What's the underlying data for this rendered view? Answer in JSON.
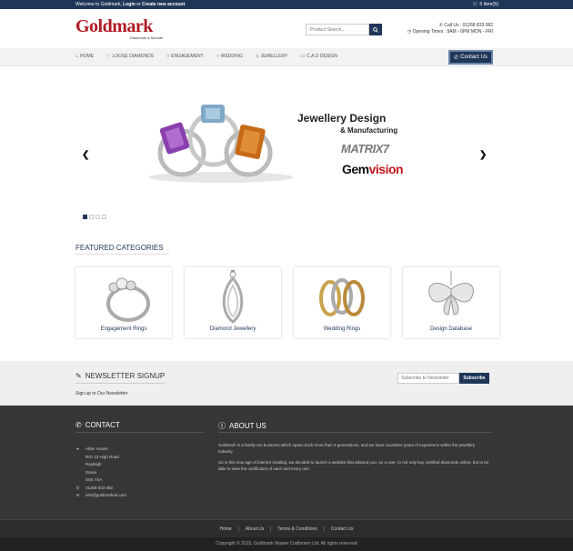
{
  "topbar": {
    "welcome_prefix": "Welcome to Goldmark,",
    "login": "Login",
    "or": "or",
    "create_account": "Create new account",
    "cart": "0 Item(S)"
  },
  "header": {
    "logo_text": "Goldmark",
    "logo_sub": "Diamonds & Mounts",
    "search_placeholder": "Product Search...",
    "call_us": "Call Us : 01268 833 082",
    "opening_times": "Opening Times : 9AM - 6PM MON - FRI"
  },
  "nav": {
    "items": [
      {
        "label": "Home"
      },
      {
        "label": "Loose Diamonds"
      },
      {
        "label": "Engagement"
      },
      {
        "label": "Wedding"
      },
      {
        "label": "Jewellery"
      },
      {
        "label": "C.A.D Design"
      }
    ],
    "contact_label": "Contact Us"
  },
  "slider": {
    "title": "Jewellery Design",
    "subtitle": "& Manufacturing",
    "matrix": "MATRIX7",
    "gem_a": "Gem",
    "gem_b": "vision",
    "slide_count": 4,
    "active_slide": 1
  },
  "featured": {
    "title": "Featured Categories",
    "cards": [
      {
        "label": "Engagement Rings"
      },
      {
        "label": "Diamond Jewellery"
      },
      {
        "label": "Wedding Rings"
      },
      {
        "label": "Design Database"
      }
    ]
  },
  "newsletter": {
    "title": "Newsletter Signup",
    "desc": "Sign up to Our Newsletter.",
    "placeholder": "Subscribe to Newsletter",
    "button": "Subscribe"
  },
  "contact": {
    "title": "Contact",
    "address": [
      "Alder House",
      "R/O 13 High Road",
      "Rayleigh",
      "Essex",
      "SS6 7SA"
    ],
    "phone": "01268 833 082",
    "email": "info@goldmarkuk.com"
  },
  "about": {
    "title": "About Us",
    "p1": "Goldmark is a family run business which spans back more than 3 generations, and we have countless years of experience within the jewellery industry.",
    "p2": "So in this new age of internet retailing, we decided to launch a website that allowed you, as a user, to not only buy certified diamonds online, but to be able to view the certificates of each and every one."
  },
  "footer_links": [
    "Home",
    "About Us",
    "Terms & Conditions",
    "Contact Us"
  ],
  "copyright": "Copyright © 2015, Goldmark Master Craftsmen Ltd. All rights reserved",
  "colors": {
    "navy": "#1f3658",
    "brand_red": "#b01a24",
    "footer_bg": "#363636"
  }
}
